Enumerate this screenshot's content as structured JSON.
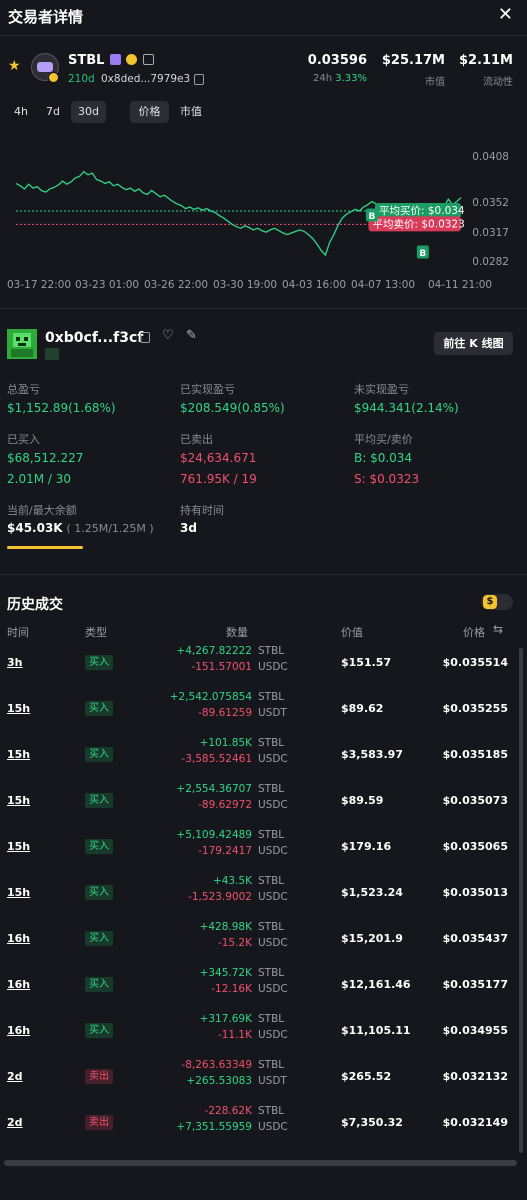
{
  "header": {
    "title": "交易者详情"
  },
  "token": {
    "symbol": "STBL",
    "age": "210d",
    "address": "0x8ded...7979e3",
    "price": "0.03596",
    "change_label": "24h",
    "change": "3.33%",
    "mcap": "$25.17M",
    "mcap_label": "市值",
    "liquidity": "$2.11M",
    "liquidity_label": "流动性"
  },
  "tabs": {
    "h4": "4h",
    "d7": "7d",
    "d30": "30d",
    "price": "价格",
    "mcap": "市值"
  },
  "chart_data": {
    "type": "line",
    "x_ticks": [
      "03-17 22:00",
      "03-23 01:00",
      "03-26 22:00",
      "03-30 19:00",
      "04-03 16:00",
      "04-07 13:00",
      "04-11 21:00"
    ],
    "y_ticks": [
      "0.0408",
      "0.0352",
      "0.0317",
      "0.0282"
    ],
    "ylim": [
      0.0265,
      0.042
    ],
    "values": [
      0.0375,
      0.0372,
      0.0368,
      0.0374,
      0.0369,
      0.0371,
      0.0366,
      0.0364,
      0.0368,
      0.037,
      0.0373,
      0.0378,
      0.0374,
      0.0377,
      0.0382,
      0.0384,
      0.039,
      0.0386,
      0.0388,
      0.038,
      0.0378,
      0.0375,
      0.0377,
      0.0372,
      0.0374,
      0.037,
      0.0367,
      0.0369,
      0.0365,
      0.0368,
      0.0363,
      0.0361,
      0.0366,
      0.0362,
      0.0358,
      0.036,
      0.0356,
      0.0352,
      0.0349,
      0.0347,
      0.0343,
      0.0345,
      0.0342,
      0.0344,
      0.0341,
      0.0343,
      0.034,
      0.0338,
      0.0334,
      0.0331,
      0.0327,
      0.0323,
      0.032,
      0.0318,
      0.0321,
      0.0319,
      0.0316,
      0.0318,
      0.0315,
      0.0313,
      0.0316,
      0.0318,
      0.0315,
      0.0312,
      0.031,
      0.0312,
      0.0314,
      0.0316,
      0.0314,
      0.031,
      0.0305,
      0.0298,
      0.029,
      0.0284,
      0.03,
      0.031,
      0.0322,
      0.0331,
      0.0336,
      0.0339,
      0.0342,
      0.034,
      0.0345,
      0.0348,
      0.0352,
      0.0349,
      0.0346,
      0.0343,
      0.034,
      0.0342,
      0.0338,
      0.0334,
      0.033,
      0.0333,
      0.0336,
      0.0338,
      0.0335,
      0.0337,
      0.034,
      0.0342,
      0.0339,
      0.0345,
      0.0355,
      0.0348,
      0.0352,
      0.0357
    ],
    "avg_buy": 0.034,
    "avg_sell": 0.0323,
    "avg_buy_label": "平均买价: $0.034",
    "avg_sell_label": "平均卖价: $0.0323",
    "markers": [
      {
        "label": "B",
        "index": 84,
        "value": 0.0352
      },
      {
        "label": "B",
        "index": 96,
        "value": 0.0305
      }
    ],
    "line_color": "#2fd58b",
    "buy_color": "#2fd58b",
    "sell_color": "#f0506e"
  },
  "trader": {
    "address": "0xb0cf...f3cf",
    "kline_button": "前往 K 线图",
    "total_pnl_label": "总盈亏",
    "total_pnl": "$1,152.89(1.68%)",
    "realized_label": "已实现盈亏",
    "realized": "$208.549(0.85%)",
    "unrealized_label": "未实现盈亏",
    "unrealized": "$944.341(2.14%)",
    "bought_label": "已买入",
    "bought_usd": "$68,512.227",
    "bought_detail": "2.01M / 30",
    "sold_label": "已卖出",
    "sold_usd": "$24,634.671",
    "sold_detail": "761.95K / 19",
    "avg_label": "平均买/卖价",
    "avg_buy": "B: $0.034",
    "avg_sell": "S: $0.0323",
    "balance_label": "当前/最大余额",
    "balance": "$45.03K",
    "balance_detail": "( 1.25M/1.25M )",
    "hold_label": "持有时间",
    "hold": "3d"
  },
  "history": {
    "title": "历史成交",
    "toggle_symbol": "$",
    "col_time": "时间",
    "col_type": "类型",
    "col_qty": "数量",
    "col_value": "价值",
    "col_price": "价格",
    "rows": [
      {
        "time": "3h",
        "type": "买入",
        "side": "buy",
        "q1": "+4,267.82222",
        "s1": "STBL",
        "q2": "-151.57001",
        "s2": "USDC",
        "value": "$151.57",
        "price": "$0.035514"
      },
      {
        "time": "15h",
        "type": "买入",
        "side": "buy",
        "q1": "+2,542.075854",
        "s1": "STBL",
        "q2": "-89.61259",
        "s2": "USDT",
        "value": "$89.62",
        "price": "$0.035255"
      },
      {
        "time": "15h",
        "type": "买入",
        "side": "buy",
        "q1": "+101.85K",
        "s1": "STBL",
        "q2": "-3,585.52461",
        "s2": "USDC",
        "value": "$3,583.97",
        "price": "$0.035185"
      },
      {
        "time": "15h",
        "type": "买入",
        "side": "buy",
        "q1": "+2,554.36707",
        "s1": "STBL",
        "q2": "-89.62972",
        "s2": "USDC",
        "value": "$89.59",
        "price": "$0.035073"
      },
      {
        "time": "15h",
        "type": "买入",
        "side": "buy",
        "q1": "+5,109.42489",
        "s1": "STBL",
        "q2": "-179.2417",
        "s2": "USDC",
        "value": "$179.16",
        "price": "$0.035065"
      },
      {
        "time": "15h",
        "type": "买入",
        "side": "buy",
        "q1": "+43.5K",
        "s1": "STBL",
        "q2": "-1,523.9002",
        "s2": "USDC",
        "value": "$1,523.24",
        "price": "$0.035013"
      },
      {
        "time": "16h",
        "type": "买入",
        "side": "buy",
        "q1": "+428.98K",
        "s1": "STBL",
        "q2": "-15.2K",
        "s2": "USDC",
        "value": "$15,201.9",
        "price": "$0.035437"
      },
      {
        "time": "16h",
        "type": "买入",
        "side": "buy",
        "q1": "+345.72K",
        "s1": "STBL",
        "q2": "-12.16K",
        "s2": "USDC",
        "value": "$12,161.46",
        "price": "$0.035177"
      },
      {
        "time": "16h",
        "type": "买入",
        "side": "buy",
        "q1": "+317.69K",
        "s1": "STBL",
        "q2": "-11.1K",
        "s2": "USDC",
        "value": "$11,105.11",
        "price": "$0.034955"
      },
      {
        "time": "2d",
        "type": "卖出",
        "side": "sell",
        "q1": "-8,263.63349",
        "s1": "STBL",
        "q2": "+265.53083",
        "s2": "USDT",
        "value": "$265.52",
        "price": "$0.032132"
      },
      {
        "time": "2d",
        "type": "卖出",
        "side": "sell",
        "q1": "-228.62K",
        "s1": "STBL",
        "q2": "+7,351.55959",
        "s2": "USDC",
        "value": "$7,350.32",
        "price": "$0.032149"
      }
    ]
  }
}
